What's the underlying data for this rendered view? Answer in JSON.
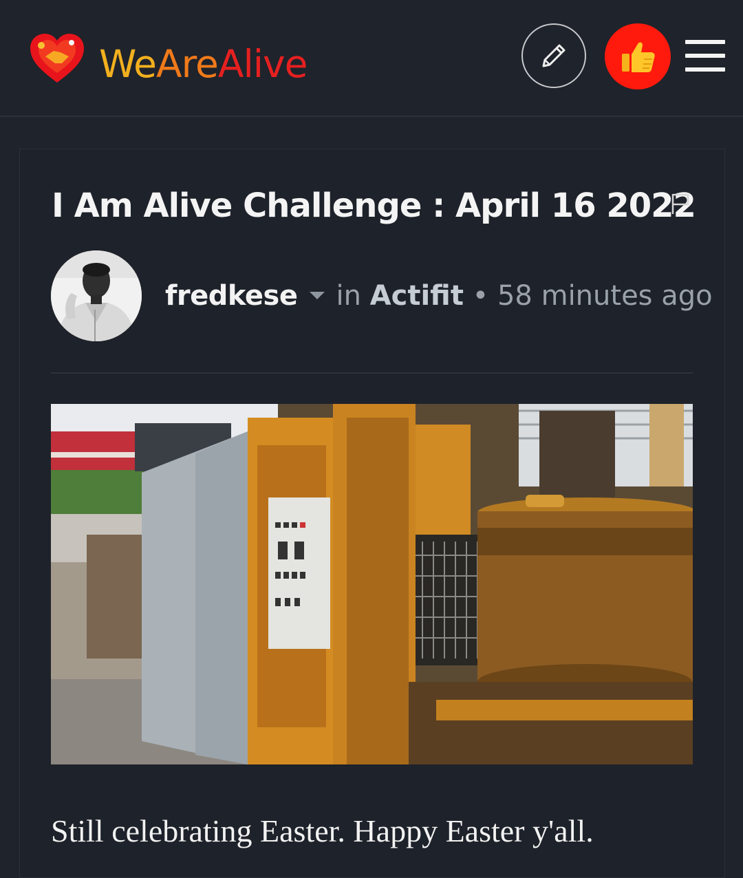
{
  "header": {
    "logo": {
      "icon": "heart-handshake-logo-icon",
      "text_parts": [
        "We",
        "Are",
        "Alive"
      ],
      "colors": {
        "we": "#f2b01e",
        "are": "#f07a1a",
        "alive": "#e62020"
      }
    },
    "edit_button": {
      "icon": "pencil-icon"
    },
    "vote_button": {
      "icon": "thumbs-up-icon",
      "color": "#ff1a0d"
    },
    "menu_button": {
      "icon": "hamburger-menu-icon"
    }
  },
  "post": {
    "title": "I Am Alive Challenge : April 16 2022",
    "flag_icon": "flag-icon",
    "author": "fredkese",
    "in_label": "in",
    "community": "Actifit",
    "separator": "•",
    "time_ago": "58 minutes ago",
    "body": "Still celebrating Easter. Happy Easter y'all."
  }
}
